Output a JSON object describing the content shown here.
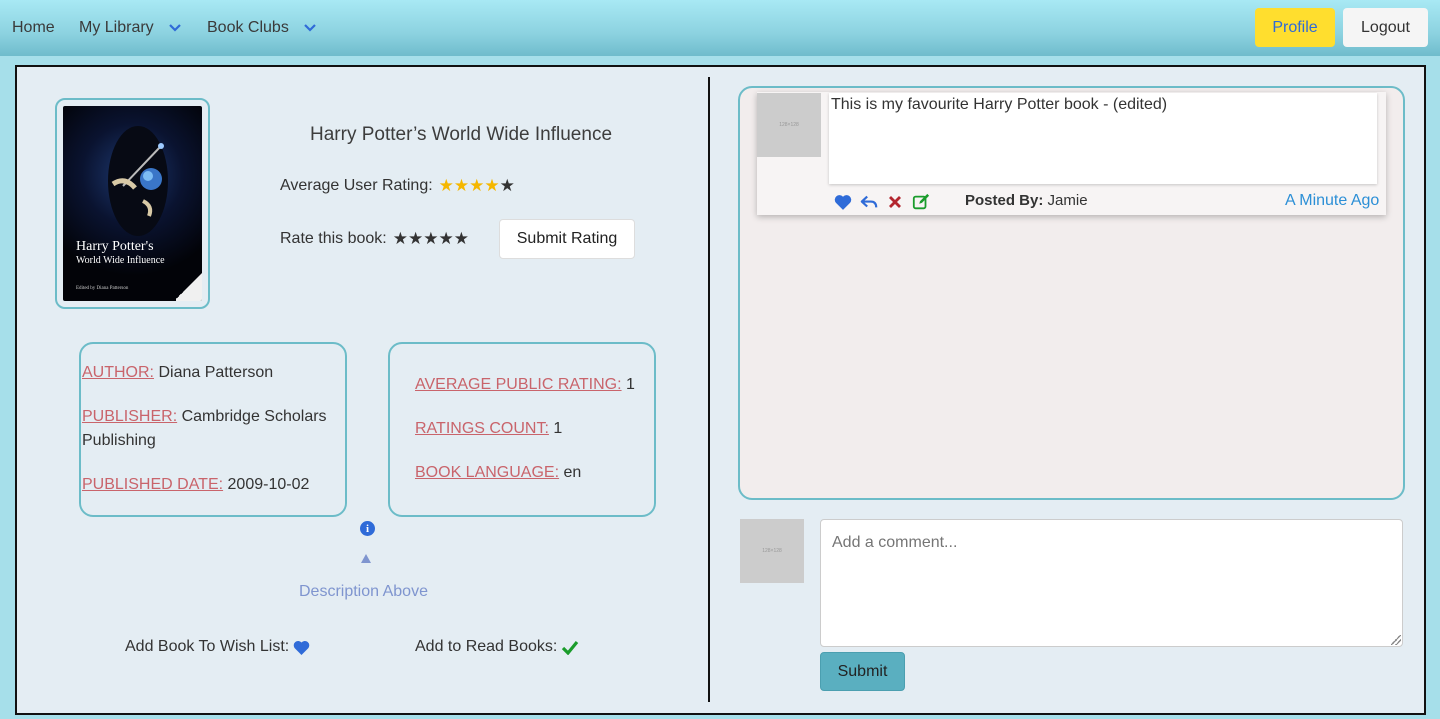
{
  "nav": {
    "home": "Home",
    "my_library": "My Library",
    "book_clubs": "Book Clubs",
    "profile": "Profile",
    "logout": "Logout"
  },
  "book": {
    "cover_title_line1": "Harry Potter's",
    "cover_title_line2": "World Wide Influence",
    "cover_editor": "Edited by Diana Patterson",
    "title": "Harry Potter’s World Wide Influence",
    "average_user_rating_label": "Average User Rating:",
    "average_user_rating_value": 4,
    "rating_max": 5,
    "rate_label": "Rate this book:",
    "rate_stars": "★★★★★",
    "submit_rating": "Submit Rating"
  },
  "details": {
    "author_key": "AUTHOR:",
    "author": "Diana Patterson",
    "publisher_key": "PUBLISHER:",
    "publisher_1": "Cambridge Scholars",
    "publisher_2": "Publishing",
    "published_date_key": "PUBLISHED DATE:",
    "published_date": "2009-10-02",
    "avg_public_key": "AVERAGE PUBLIC RATING:",
    "avg_public": "1",
    "ratings_count_key": "RATINGS COUNT:",
    "ratings_count": "1",
    "language_key": "BOOK LANGUAGE:",
    "language": "en"
  },
  "description_above": "Description Above",
  "actions": {
    "wish_list": "Add Book To Wish List:",
    "read_books": "Add to Read Books:"
  },
  "comment": {
    "avatar_text": "128×128",
    "text": "This is my favourite Harry Potter book - (edited)",
    "posted_by_label": "Posted By:",
    "posted_by": "Jamie",
    "time": "A Minute Ago"
  },
  "new_comment": {
    "avatar_text": "128×128",
    "placeholder": "Add a comment...",
    "submit": "Submit"
  },
  "colors": {
    "accent_border": "#6cbcc8",
    "key_red": "#c9646b",
    "profile_yellow": "#ffde2e",
    "link_blue": "#2c8fd6"
  }
}
